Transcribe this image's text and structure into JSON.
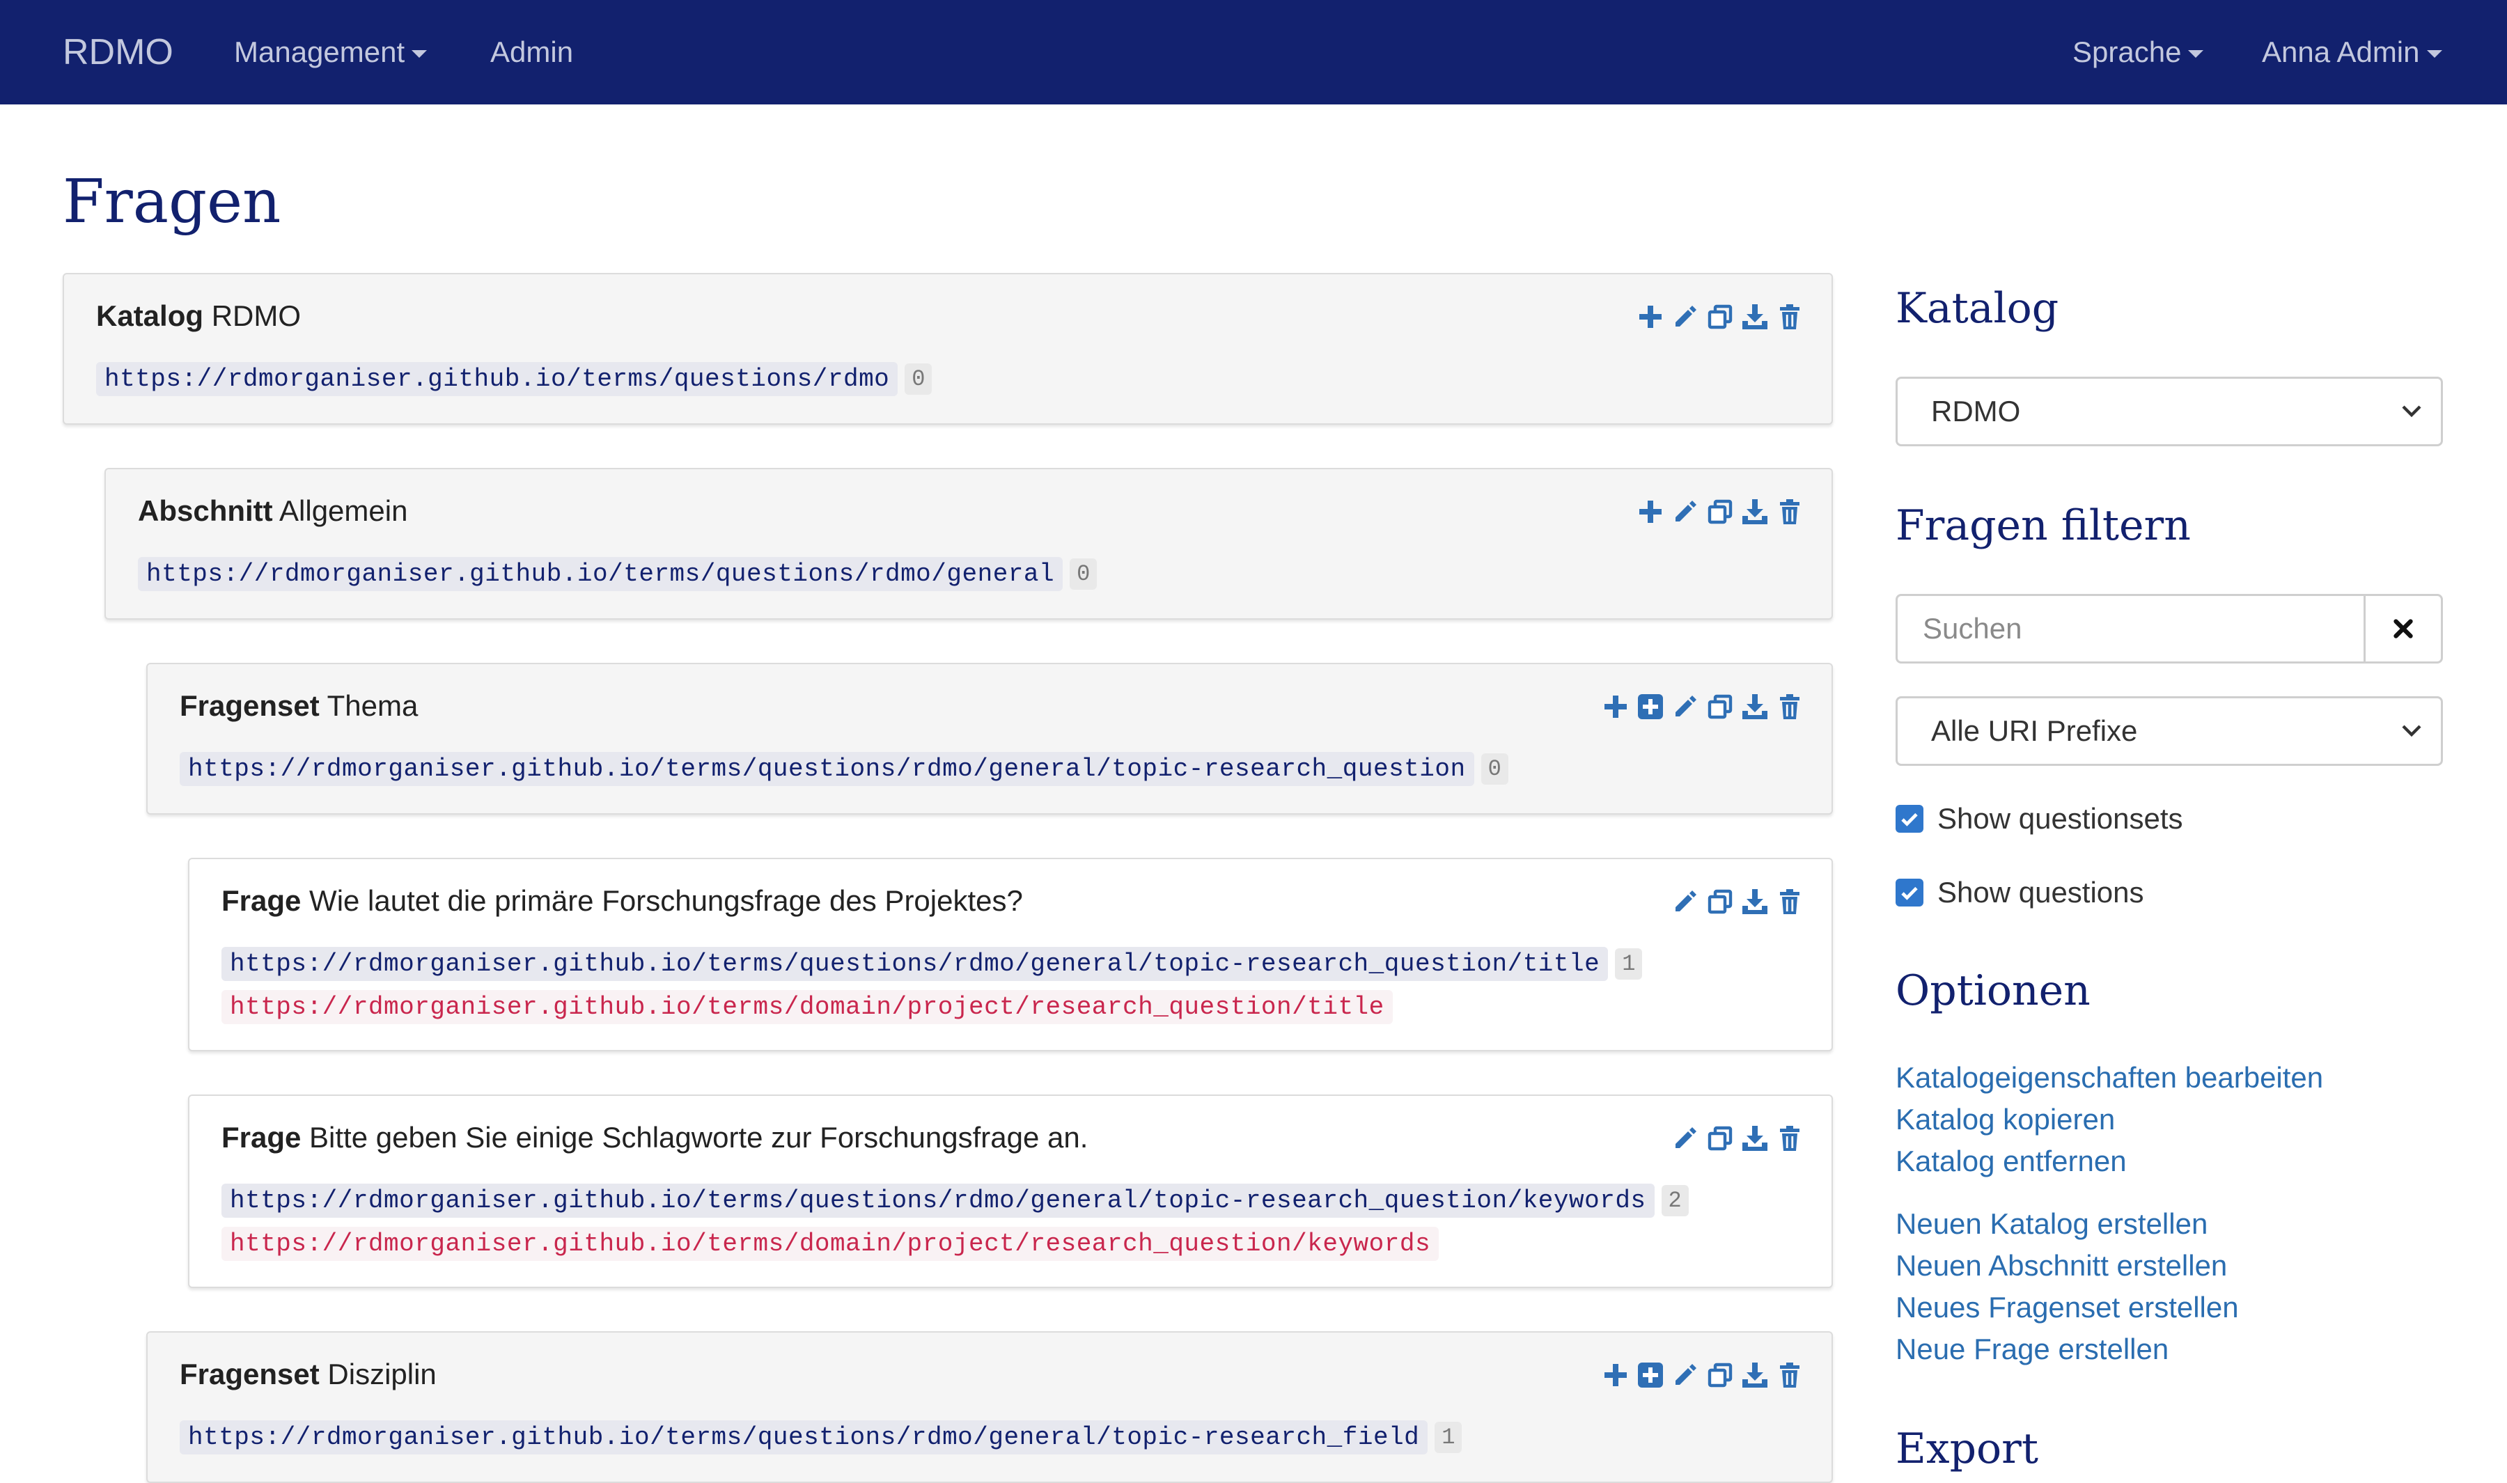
{
  "navbar": {
    "brand": "RDMO",
    "management": "Management",
    "admin": "Admin",
    "language": "Sprache",
    "user": "Anna Admin"
  },
  "page": {
    "title": "Fragen"
  },
  "elements": [
    {
      "type_label": "Katalog",
      "name": "RDMO",
      "uri": "https://rdmorganiser.github.io/terms/questions/rdmo",
      "count": "0"
    },
    {
      "type_label": "Abschnitt",
      "name": "Allgemein",
      "uri": "https://rdmorganiser.github.io/terms/questions/rdmo/general",
      "count": "0"
    },
    {
      "type_label": "Fragenset",
      "name": "Thema",
      "uri": "https://rdmorganiser.github.io/terms/questions/rdmo/general/topic-research_question",
      "count": "0"
    },
    {
      "type_label": "Frage",
      "name": "Wie lautet die primäre Forschungsfrage des Projektes?",
      "uri": "https://rdmorganiser.github.io/terms/questions/rdmo/general/topic-research_question/title",
      "count": "1",
      "attribute_uri": "https://rdmorganiser.github.io/terms/domain/project/research_question/title"
    },
    {
      "type_label": "Frage",
      "name": "Bitte geben Sie einige Schlagworte zur Forschungsfrage an.",
      "uri": "https://rdmorganiser.github.io/terms/questions/rdmo/general/topic-research_question/keywords",
      "count": "2",
      "attribute_uri": "https://rdmorganiser.github.io/terms/domain/project/research_question/keywords"
    },
    {
      "type_label": "Fragenset",
      "name": "Disziplin",
      "uri": "https://rdmorganiser.github.io/terms/questions/rdmo/general/topic-research_field",
      "count": "1"
    }
  ],
  "sidebar": {
    "catalog_heading": "Katalog",
    "catalog_selected": "RDMO",
    "filter_heading": "Fragen filtern",
    "search_placeholder": "Suchen",
    "uri_prefix_selected": "Alle URI Prefixe",
    "show_questionsets": "Show questionsets",
    "show_questions": "Show questions",
    "show_questionsets_checked": true,
    "show_questions_checked": true,
    "options_heading": "Optionen",
    "links_edit": [
      "Katalogeigenschaften bearbeiten",
      "Katalog kopieren",
      "Katalog entfernen"
    ],
    "links_create": [
      "Neuen Katalog erstellen",
      "Neuen Abschnitt erstellen",
      "Neues Fragenset erstellen",
      "Neue Frage erstellen"
    ],
    "export_heading": "Export"
  },
  "colors": {
    "navbar": "#12216e",
    "heading": "#12216e",
    "link": "#2a6db0",
    "icon": "#2f6fb5",
    "attribute_uri": "#c9264d"
  },
  "icons": [
    "plus-icon",
    "plus-square-icon",
    "pencil-icon",
    "copy-icon",
    "download-icon",
    "trash-icon",
    "close-icon",
    "chevron-down-icon",
    "checkmark-icon"
  ]
}
